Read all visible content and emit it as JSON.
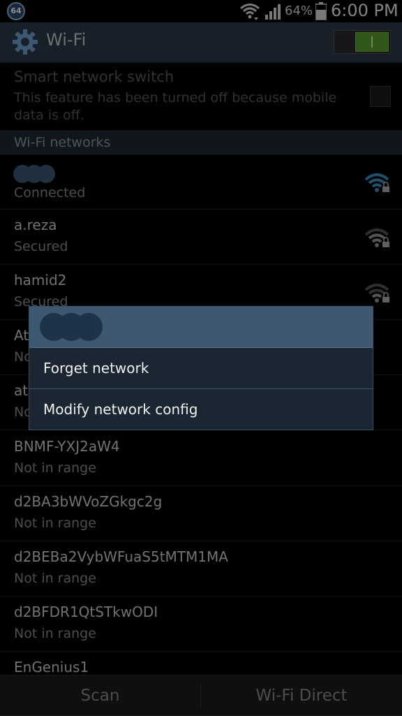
{
  "status_bar": {
    "notification_badge": "64",
    "battery_percent": "64%",
    "time": "6:00 PM",
    "icons": [
      "wifi-signal-icon",
      "cell-signal-icon",
      "battery-icon"
    ]
  },
  "header": {
    "title": "Wi-Fi",
    "icon": "gear-icon",
    "toggle_state": "on",
    "accent_color": "#5a9e2e"
  },
  "smart_network_switch": {
    "title": "Smart network switch",
    "description": "This feature has been turned off because mobile data is off.",
    "checked": false
  },
  "section_label": "Wi-Fi networks",
  "networks": [
    {
      "name": "",
      "status": "Connected",
      "signal_icon": "wifi-locked-strong-icon"
    },
    {
      "name": "a.reza",
      "status": "Secured",
      "signal_icon": "wifi-locked-medium-icon"
    },
    {
      "name": "hamid2",
      "status": "Secured",
      "signal_icon": "wifi-locked-weak-icon"
    },
    {
      "name": "At",
      "status": "No"
    },
    {
      "name": "at",
      "status": "No"
    },
    {
      "name": "BNMF-YXJ2aW4",
      "status": "Not in range"
    },
    {
      "name": "d2BA3bWVoZGkgc2g",
      "status": "Not in range"
    },
    {
      "name": "d2BEBa2VybWFuaS5tMTM1MA",
      "status": "Not in range"
    },
    {
      "name": "d2BFDR1QtSTkwODI",
      "status": "Not in range"
    },
    {
      "name": "EnGenius1",
      "status": ""
    }
  ],
  "bottom_bar": {
    "scan_label": "Scan",
    "wifi_direct_label": "Wi-Fi Direct"
  },
  "dialog": {
    "title": "",
    "items": [
      "Forget network",
      "Modify network config"
    ]
  }
}
